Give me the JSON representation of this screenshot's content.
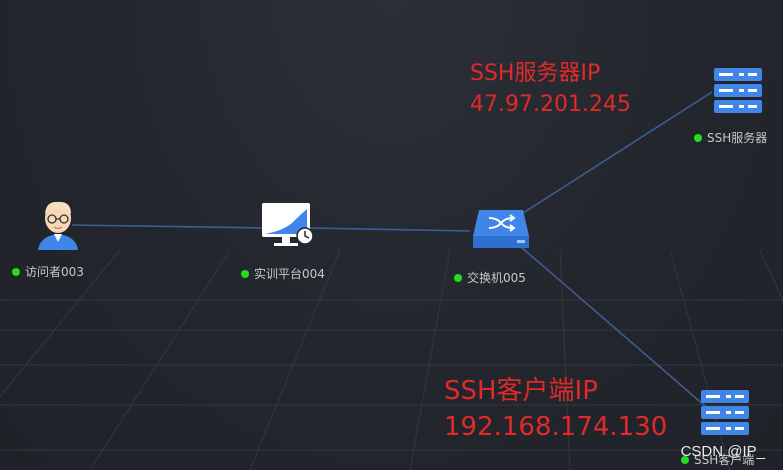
{
  "nodes": {
    "visitor": {
      "label": "访问者003"
    },
    "platform": {
      "label": "实训平台004"
    },
    "switch": {
      "label": "交换机005"
    },
    "ssh_server": {
      "label": "SSH服务器"
    },
    "ssh_client": {
      "label": "SSH客户端"
    }
  },
  "annotations": {
    "server_title": "SSH服务器IP",
    "server_ip": "47.97.201.245",
    "client_title": "SSH客户端IP",
    "client_ip": "192.168.174.130"
  },
  "watermark": "CSDN @IP_",
  "colors": {
    "background": "#23262d",
    "link": "#3d5e8f",
    "annotation": "#e02a2a",
    "status_online": "#22dd22",
    "device_blue": "#3f86e8"
  }
}
